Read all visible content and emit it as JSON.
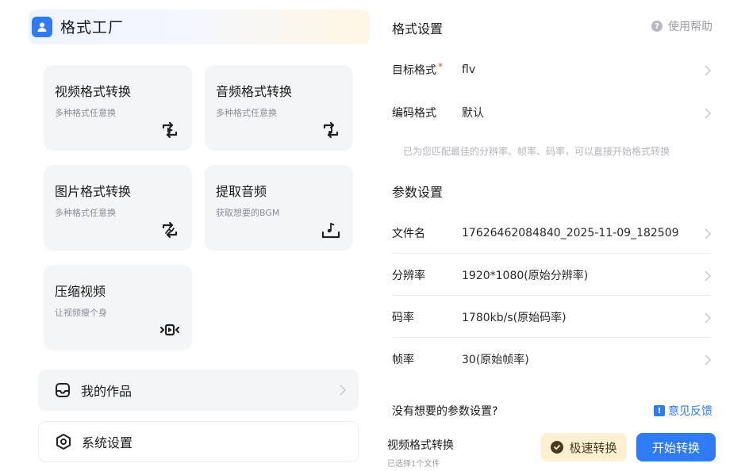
{
  "app": {
    "title": "格式工厂"
  },
  "tools": [
    {
      "title": "视频格式转换",
      "subtitle": "多种格式任意换",
      "icon": "video-convert-icon"
    },
    {
      "title": "音频格式转换",
      "subtitle": "多种格式任意换",
      "icon": "audio-convert-icon"
    },
    {
      "title": "图片格式转换",
      "subtitle": "多种格式任意换",
      "icon": "image-convert-icon"
    },
    {
      "title": "提取音频",
      "subtitle": "获取想要的BGM",
      "icon": "extract-audio-icon"
    },
    {
      "title": "压缩视频",
      "subtitle": "让视频瘦个身",
      "icon": "compress-video-icon"
    }
  ],
  "nav": {
    "my_works": "我的作品",
    "settings": "系统设置"
  },
  "format": {
    "section_title": "格式设置",
    "help": "使用帮助",
    "target_label": "目标格式",
    "required_mark": "*",
    "target_value": "flv",
    "codec_label": "编码格式",
    "codec_value": "默认",
    "hint": "已为您匹配最佳的分辨率、帧率、码率，可以直接开始格式转换"
  },
  "params": {
    "section_title": "参数设置",
    "filename_label": "文件名",
    "filename_value": "17626462084840_2025-11-09_182509",
    "resolution_label": "分辨率",
    "resolution_value": "1920*1080(原始分辨率)",
    "bitrate_label": "码率",
    "bitrate_value": "1780kb/s(原始码率)",
    "framerate_label": "帧率",
    "framerate_value": "30(原始帧率)"
  },
  "footer": {
    "missing": "没有想要的参数设置?",
    "feedback": "意见反馈",
    "task_title": "视频格式转换",
    "task_sub": "已选择1个文件",
    "fast_convert": "极速转换",
    "start_convert": "开始转换"
  },
  "colors": {
    "accent": "#2f7bf5",
    "fast_bg": "#fdf0d2",
    "card_bg": "#f4f5f7"
  }
}
